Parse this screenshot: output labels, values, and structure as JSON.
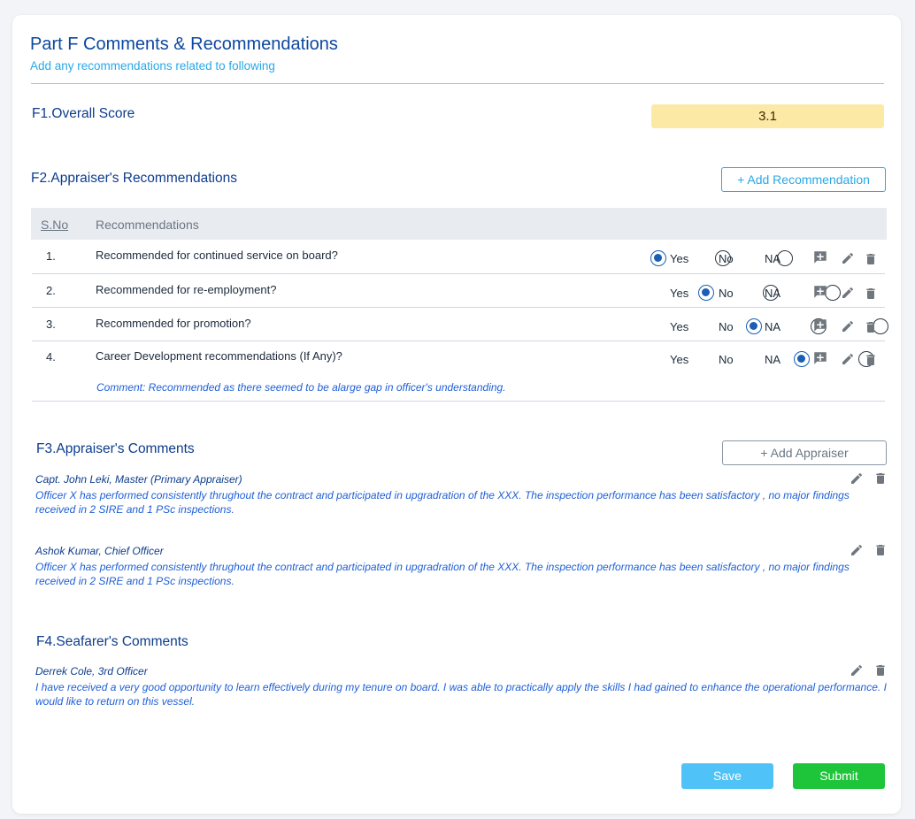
{
  "header": {
    "title": "Part F Comments & Recommendations",
    "subtitle": "Add any recommendations related to following"
  },
  "f1": {
    "label": "F1.Overall Score",
    "score": "3.1"
  },
  "f2": {
    "label": "F2.Appraiser's Recommendations",
    "add_button": "+ Add Recommendation",
    "col_sno": "S.No",
    "col_recommendations": "Recommendations",
    "options": [
      "Yes",
      "No",
      "NA"
    ],
    "rows": [
      {
        "sno": "1.",
        "question": "Recommended for continued service on board?",
        "selected": "Yes"
      },
      {
        "sno": "2.",
        "question": "Recommended for re-employment?",
        "selected": "Yes"
      },
      {
        "sno": "3.",
        "question": "Recommended for promotion?",
        "selected": "Yes"
      },
      {
        "sno": "4.",
        "question": "Career Development recommendations (If Any)?",
        "selected": "Yes",
        "comment": "Comment: Recommended as there seemed to be alarge gap in officer's understanding."
      }
    ]
  },
  "f3": {
    "label": "F3.Appraiser's Comments",
    "add_button": "+ Add Appraiser",
    "comments": [
      {
        "author": "Capt. John Leki, Master (Primary Appraiser)",
        "text": "Officer X has performed consistently thrughout the contract and participated in upgradration of the XXX. The inspection performance has been satisfactory , no major findings received in 2 SIRE and 1 PSc inspections."
      },
      {
        "author": "Ashok Kumar, Chief Officer",
        "text": "Officer X has performed consistently thrughout the contract and participated in upgradration of the XXX. The inspection performance has been satisfactory , no major findings received in 2 SIRE and 1 PSc inspections."
      }
    ]
  },
  "f4": {
    "label": "F4.Seafarer's Comments",
    "comments": [
      {
        "author": "Derrek Cole, 3rd Officer",
        "text": "I have received a very good opportunity to learn effectively during my tenure on board. I was able to practically apply the skills I had gained to enhance the operational performance. I would like to return on this vessel."
      }
    ]
  },
  "footer": {
    "save_label": "Save",
    "submit_label": "Submit"
  },
  "icons": {
    "add_comment": "add-comment-icon",
    "edit": "pencil-icon",
    "delete": "trash-icon"
  },
  "colors": {
    "title": "#0d47a1",
    "accent": "#29a8e6",
    "score_bg": "#fde9a6",
    "save": "#4fc3f7",
    "submit": "#1ec439",
    "radio_selected": "#1a5fb4"
  }
}
